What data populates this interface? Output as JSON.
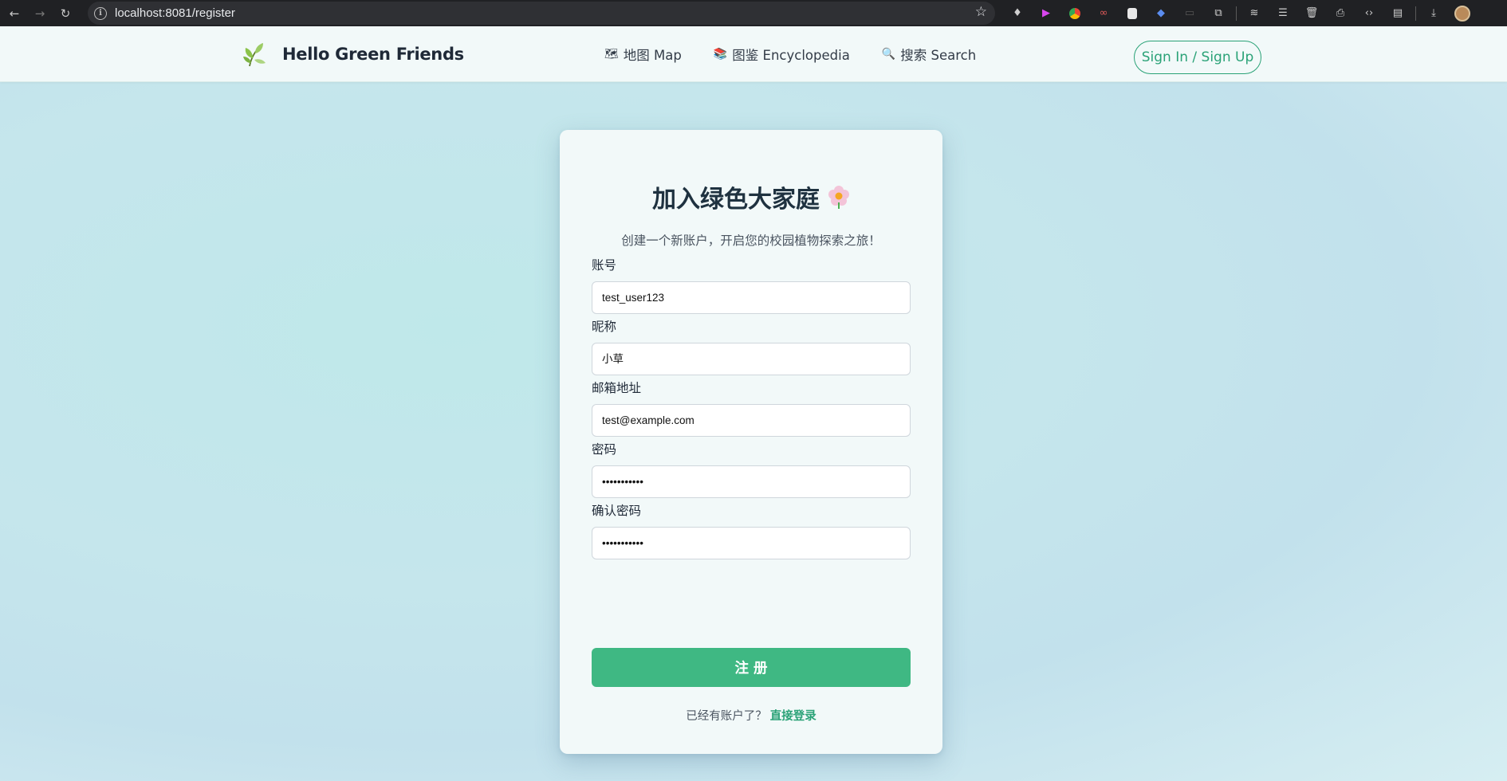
{
  "browser": {
    "url": "localhost:8081/register",
    "back_icon": "back-arrow-icon",
    "forward_icon": "forward-arrow-icon",
    "reload_icon": "reload-icon"
  },
  "header": {
    "brand_name": "Hello Green Friends",
    "nav": [
      {
        "icon": "🗺",
        "label": "地图 Map"
      },
      {
        "icon": "📚",
        "label": "图鉴 Encyclopedia"
      },
      {
        "icon": "🔍",
        "label": "搜索 Search"
      }
    ],
    "signin_label": "Sign In / Sign Up"
  },
  "form": {
    "title": "加入绿色大家庭",
    "subtitle": "创建一个新账户，开启您的校园植物探索之旅！",
    "fields": [
      {
        "label": "账号",
        "value": "test_user123"
      },
      {
        "label": "昵称",
        "value": "小草"
      },
      {
        "label": "邮箱地址",
        "value": "test@example.com"
      },
      {
        "label": "密码",
        "value": "•••••••••••"
      },
      {
        "label": "确认密码",
        "value": "•••••••••••"
      }
    ],
    "submit_label": "注册",
    "login_prompt": "已经有账户了？",
    "login_link": "直接登录"
  },
  "colors": {
    "accent": "#3fb883",
    "link": "#2aa277",
    "title": "#1f3240"
  }
}
